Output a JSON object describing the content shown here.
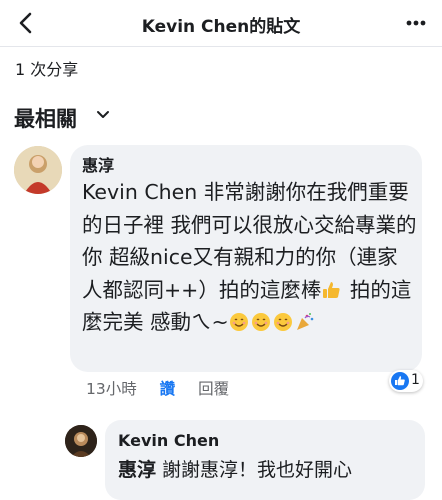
{
  "header": {
    "title": "Kevin Chen的貼文",
    "back_icon": "chevron-left-icon",
    "more_icon": "more-dots-icon"
  },
  "post": {
    "share_count": "1 次分享"
  },
  "comments_sort": {
    "label": "最相關",
    "icon": "chevron-down-icon"
  },
  "comments": [
    {
      "author": "惠淳",
      "text_main": "Kevin Chen 非常謝謝你在我們重要的日子裡 我們可以很放心交給專業的你 超級nice又有親和力的你（連家人都認同++）拍的這麼棒",
      "text_mid": " 拍的這麼完美 感動ㄟ~",
      "emojis": [
        "thumbs-up-emoji",
        "smile-emoji",
        "smile-emoji",
        "smile-emoji",
        "party-popper-emoji"
      ],
      "time": "13小時",
      "like_label": "讚",
      "reply_label": "回覆",
      "reaction_count": "1",
      "reaction_icon": "like-reaction-icon"
    },
    {
      "author": "Kevin Chen",
      "mention": "惠淳",
      "text": " 謝謝惠淳！我也好開心"
    }
  ],
  "colors": {
    "accent": "#1877f2",
    "bubble": "#f0f2f5",
    "muted": "#65676b"
  }
}
